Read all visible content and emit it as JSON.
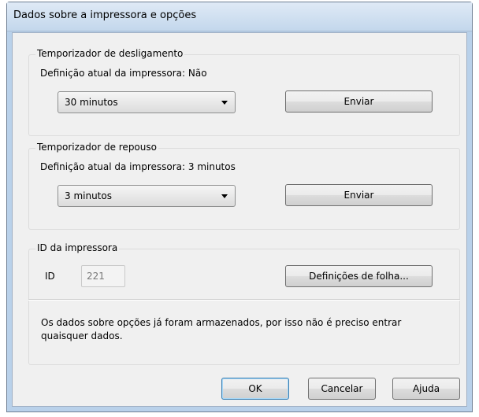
{
  "window": {
    "title": "Dados sobre a impressora e opções"
  },
  "shutdown_timer": {
    "legend": "Temporizador de desligamento",
    "current_setting": "Definição atual da impressora: Não",
    "selected_value": "30 minutos",
    "send_label": "Enviar"
  },
  "sleep_timer": {
    "legend": "Temporizador de repouso",
    "current_setting": "Definição atual da impressora: 3 minutos",
    "selected_value": "3 minutos",
    "send_label": "Enviar"
  },
  "printer_id": {
    "legend": "ID da impressora",
    "id_label": "ID",
    "id_value": "221",
    "sheet_settings_label": "Definições de folha...",
    "note": "Os dados sobre opções já foram armazenados, por isso não é preciso entrar quaisquer dados."
  },
  "footer": {
    "ok_label": "OK",
    "cancel_label": "Cancelar",
    "help_label": "Ajuda"
  }
}
